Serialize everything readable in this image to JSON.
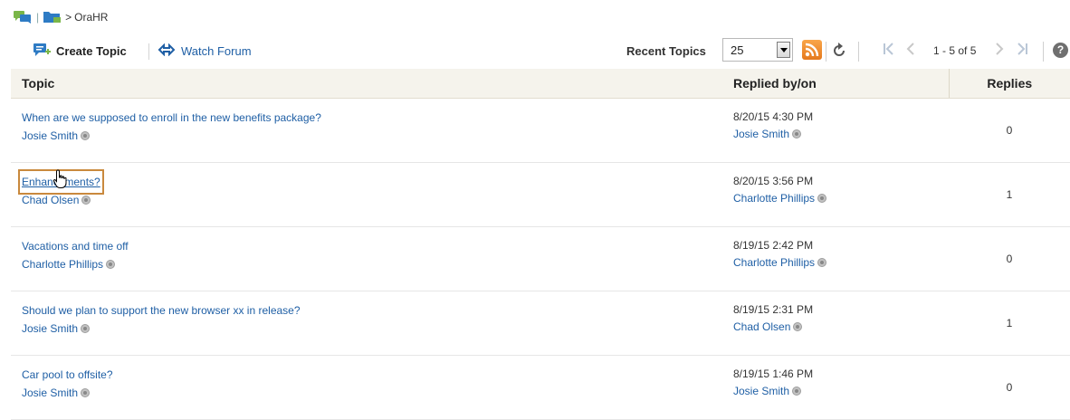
{
  "breadcrumb": {
    "separator": ">",
    "current": "OraHR"
  },
  "toolbar": {
    "create_topic": "Create Topic",
    "watch_forum": "Watch Forum",
    "recent_label": "Recent Topics",
    "recent_value": "25",
    "range": "1 - 5 of 5"
  },
  "table": {
    "headers": {
      "topic": "Topic",
      "replied": "Replied by/on",
      "replies": "Replies"
    },
    "rows": [
      {
        "title": "When are we supposed to enroll in the new benefits package?",
        "author": "Josie Smith",
        "date": "8/20/15 4:30 PM",
        "replied_by": "Josie Smith",
        "replies": "0"
      },
      {
        "title": "Enhancements?",
        "author": "Chad Olsen",
        "date": "8/20/15 3:56 PM",
        "replied_by": "Charlotte Phillips",
        "replies": "1"
      },
      {
        "title": "Vacations and time off",
        "author": "Charlotte Phillips",
        "date": "8/19/15 2:42 PM",
        "replied_by": "Charlotte Phillips",
        "replies": "0"
      },
      {
        "title": "Should we plan to support the new browser xx in release?",
        "author": "Josie Smith",
        "date": "8/19/15 2:31 PM",
        "replied_by": "Chad Olsen",
        "replies": "1"
      },
      {
        "title": "Car pool to offsite?",
        "author": "Josie Smith",
        "date": "8/19/15 1:46 PM",
        "replied_by": "Josie Smith",
        "replies": "0"
      }
    ]
  },
  "icons": {
    "forum_home": "chat-bubbles-icon",
    "folder": "folder-icon",
    "create": "create-topic-icon",
    "watch": "watch-arrows-icon",
    "rss": "rss-feed-icon",
    "refresh": "refresh-icon",
    "first": "first-page-icon",
    "prev": "previous-page-icon",
    "next": "next-page-icon",
    "last": "last-page-icon",
    "help": "help-icon",
    "presence": "presence-status-icon",
    "cursor": "hand-pointer-icon"
  },
  "colors": {
    "link": "#1f5fa5",
    "header_bg": "#f5f3ec",
    "highlight": "#c9893d",
    "rss": "#f39a3a"
  }
}
